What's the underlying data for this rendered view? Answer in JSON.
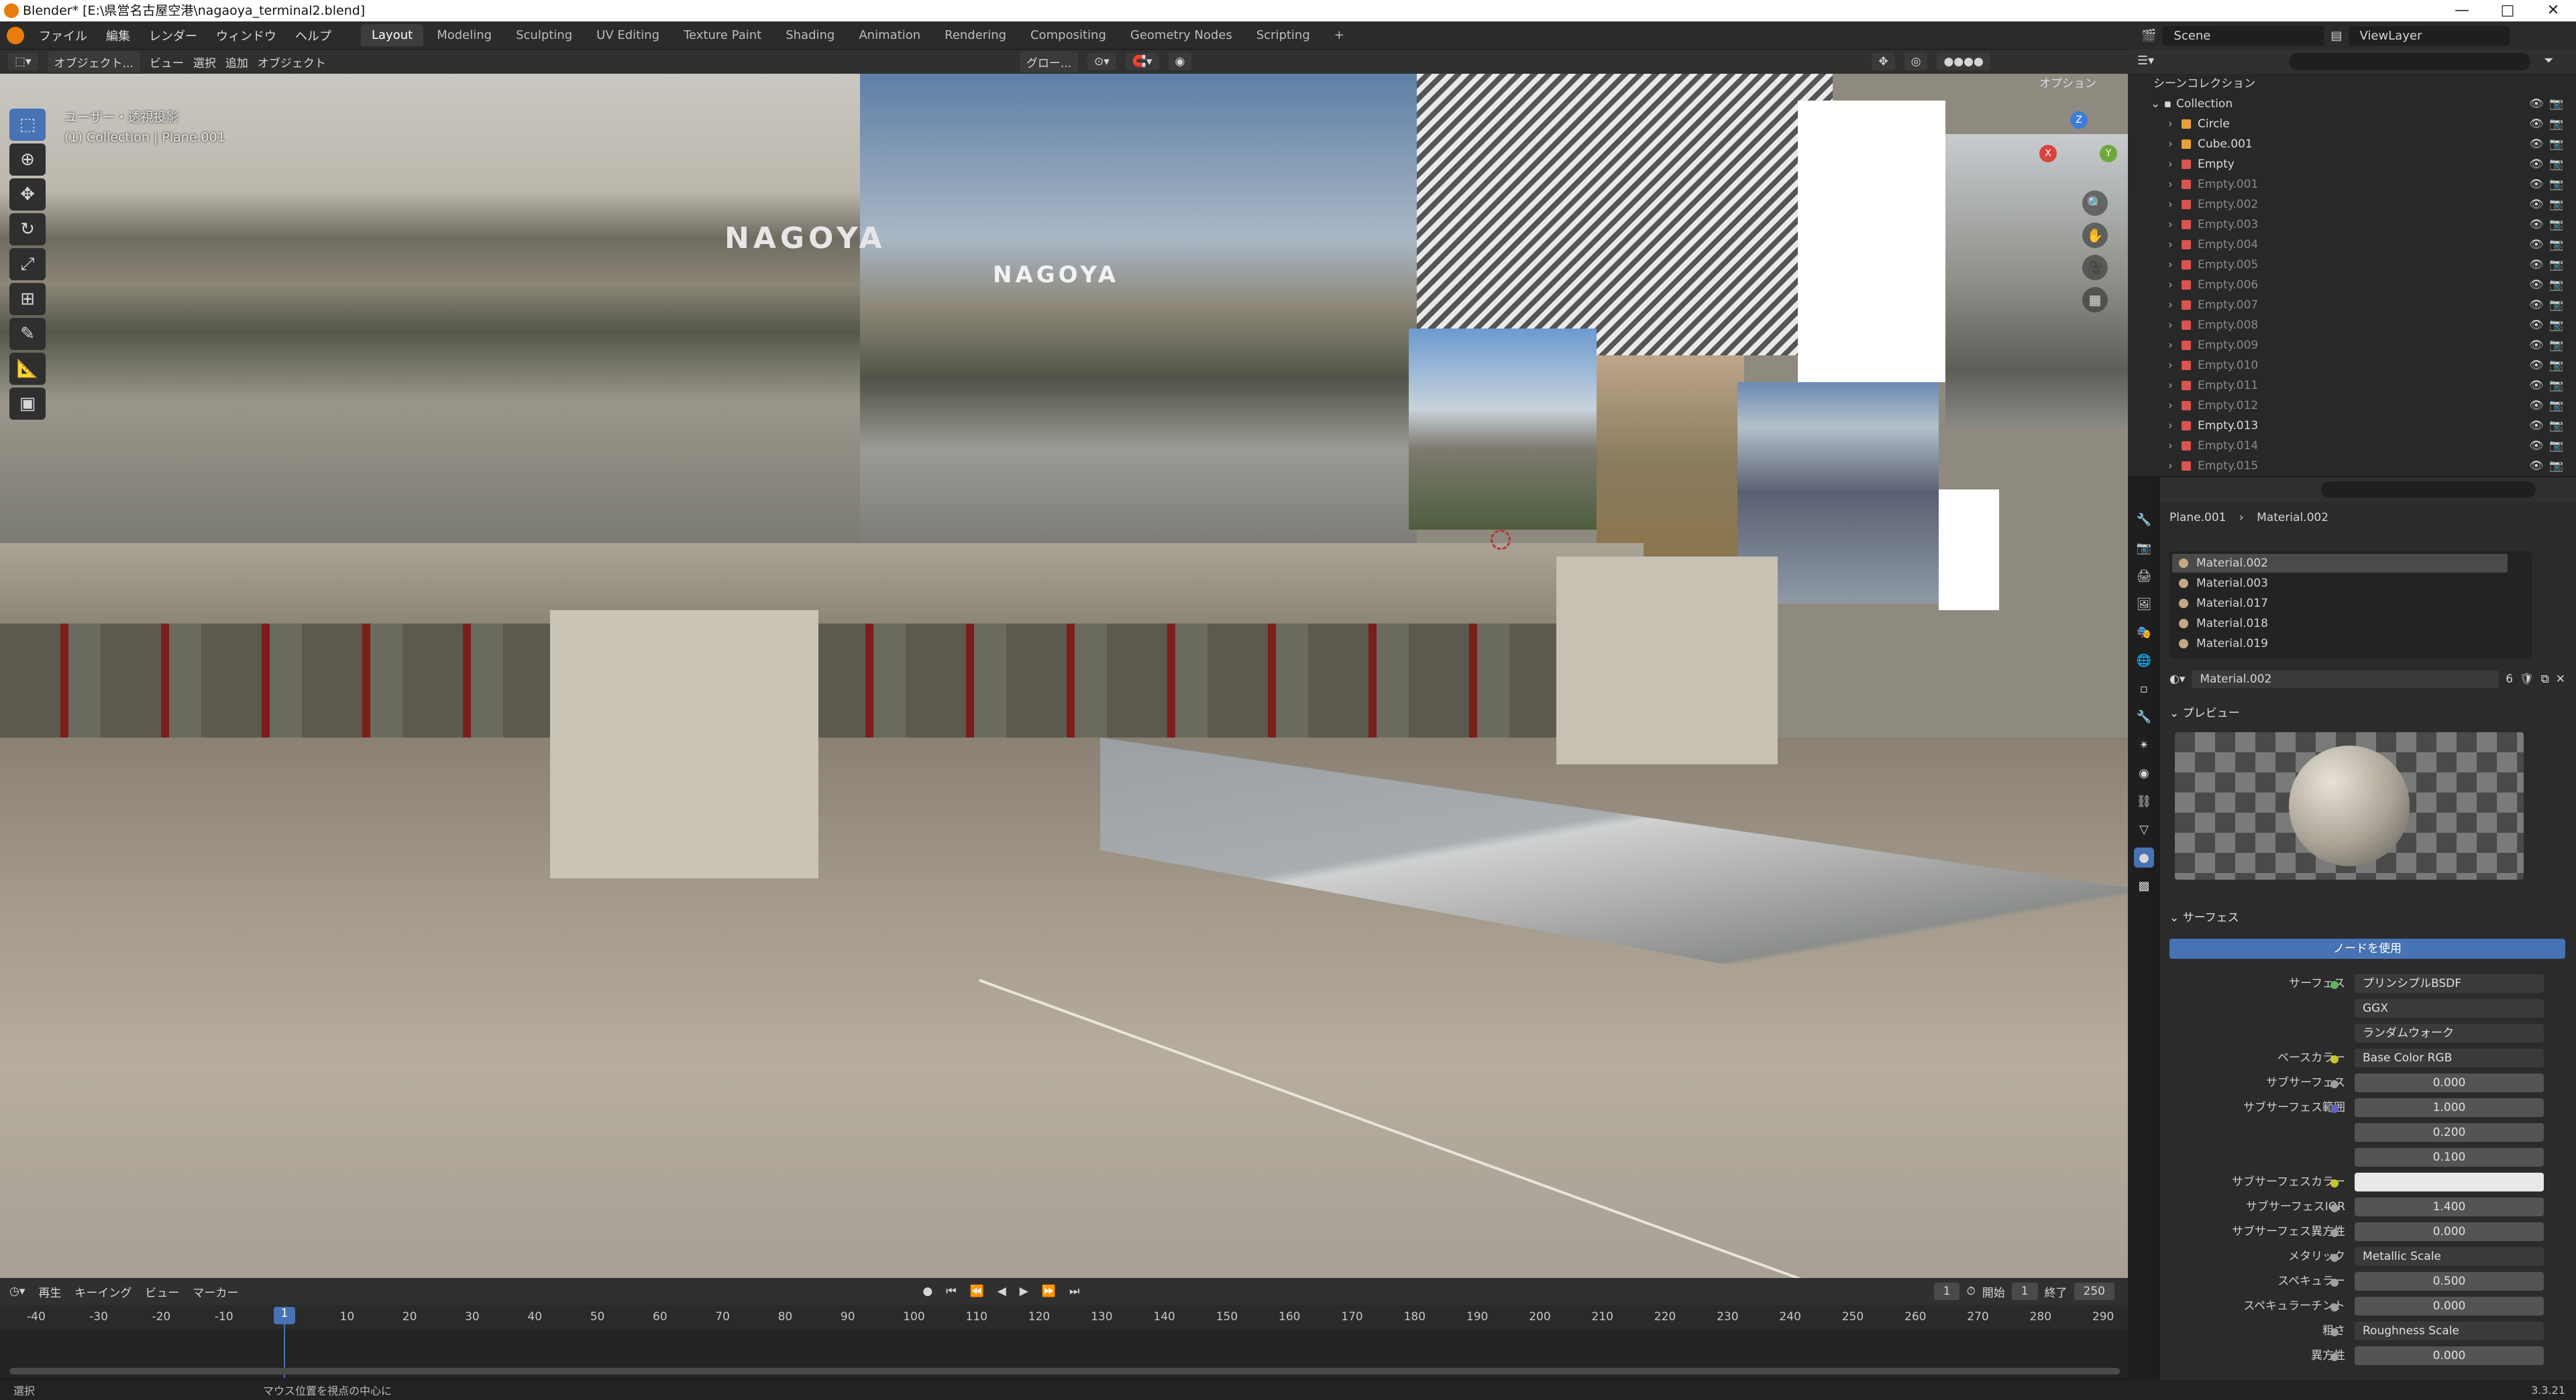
{
  "title_bar": {
    "text": "Blender* [E:\\県営名古屋空港\\nagaoya_terminal2.blend]",
    "min": "—",
    "max": "□",
    "close": "✕"
  },
  "top_menu": [
    "ファイル",
    "編集",
    "レンダー",
    "ウィンドウ",
    "ヘルプ"
  ],
  "workspaces": [
    "Layout",
    "Modeling",
    "Sculpting",
    "UV Editing",
    "Texture Paint",
    "Shading",
    "Animation",
    "Rendering",
    "Compositing",
    "Geometry Nodes",
    "Scripting",
    "+"
  ],
  "active_workspace": "Layout",
  "scene": {
    "label": "Scene",
    "view_layer": "ViewLayer"
  },
  "viewport_header": {
    "mode": "オブジェクト...",
    "menus": [
      "ビュー",
      "選択",
      "追加",
      "オブジェクト"
    ],
    "transform": "グロー...",
    "options": "オプション"
  },
  "viewport_info": {
    "line1": "ユーザー・透視投影",
    "line2": "(1) Collection | Plane.001",
    "sign1": "NAGOYA",
    "sign2": "NAGOYA"
  },
  "gizmo": {
    "x": "X",
    "y": "Y",
    "z": "Z"
  },
  "tools": [
    "select",
    "cursor",
    "move",
    "rotate",
    "scale",
    "transform",
    "annotate",
    "measure",
    "add-cube"
  ],
  "timeline": {
    "menus": [
      "再生",
      "キーイング",
      "ビュー",
      "マーカー"
    ],
    "current_frame": "1",
    "start_label": "開始",
    "start": "1",
    "end_label": "終了",
    "end": "250",
    "ticks": [
      "-40",
      "-30",
      "-20",
      "-10",
      "1",
      "10",
      "20",
      "30",
      "40",
      "50",
      "60",
      "70",
      "80",
      "90",
      "100",
      "110",
      "120",
      "130",
      "140",
      "150",
      "160",
      "170",
      "180",
      "190",
      "200",
      "210",
      "220",
      "230",
      "240",
      "250",
      "260",
      "270",
      "280",
      "290"
    ]
  },
  "status_bar": {
    "left": "選択",
    "middle": "マウス位置を視点の中心に",
    "version": "3.3.21"
  },
  "outliner": {
    "root": "シーンコレクション",
    "collection": "Collection",
    "items": [
      {
        "name": "Circle",
        "type": "mesh"
      },
      {
        "name": "Cube.001",
        "type": "mesh"
      },
      {
        "name": "Empty",
        "type": "empty"
      },
      {
        "name": "Empty.001",
        "type": "empty",
        "dim": true
      },
      {
        "name": "Empty.002",
        "type": "empty",
        "dim": true
      },
      {
        "name": "Empty.003",
        "type": "empty",
        "dim": true
      },
      {
        "name": "Empty.004",
        "type": "empty",
        "dim": true
      },
      {
        "name": "Empty.005",
        "type": "empty",
        "dim": true
      },
      {
        "name": "Empty.006",
        "type": "empty",
        "dim": true
      },
      {
        "name": "Empty.007",
        "type": "empty",
        "dim": true
      },
      {
        "name": "Empty.008",
        "type": "empty",
        "dim": true
      },
      {
        "name": "Empty.009",
        "type": "empty",
        "dim": true
      },
      {
        "name": "Empty.010",
        "type": "empty",
        "dim": true
      },
      {
        "name": "Empty.011",
        "type": "empty",
        "dim": true
      },
      {
        "name": "Empty.012",
        "type": "empty",
        "dim": true
      },
      {
        "name": "Empty.013",
        "type": "empty"
      },
      {
        "name": "Empty.014",
        "type": "empty",
        "dim": true
      },
      {
        "name": "Empty.015",
        "type": "empty",
        "dim": true
      }
    ]
  },
  "properties": {
    "breadcrumb": {
      "object": "Plane.001",
      "material": "Material.002"
    },
    "slots": [
      "Material.002",
      "Material.003",
      "Material.017",
      "Material.018",
      "Material.019"
    ],
    "active_slot": "Material.002",
    "material_name": "Material.002",
    "user_count": "6",
    "preview_label": "プレビュー",
    "surface_label": "サーフェス",
    "use_nodes": "ノードを使用",
    "fields": [
      {
        "label": "サーフェス",
        "value": "プリンシプルBSDF",
        "kind": "link",
        "dot": "#5fb55f"
      },
      {
        "label": "",
        "value": "GGX",
        "kind": "menu"
      },
      {
        "label": "",
        "value": "ランダムウォーク",
        "kind": "menu"
      },
      {
        "label": "ベースカラー",
        "value": "Base Color RGB",
        "kind": "link",
        "dot": "#c7c729"
      },
      {
        "label": "サブサーフェス",
        "value": "0.000",
        "kind": "num",
        "dot": "#a0a0a0"
      },
      {
        "label": "サブサーフェス範囲",
        "value": "1.000",
        "kind": "num",
        "dot": "#6363c7"
      },
      {
        "label": "",
        "value": "0.200",
        "kind": "num"
      },
      {
        "label": "",
        "value": "0.100",
        "kind": "num"
      },
      {
        "label": "サブサーフェスカラー",
        "value": "",
        "kind": "color",
        "dot": "#c7c729"
      },
      {
        "label": "サブサーフェスIOR",
        "value": "1.400",
        "kind": "num",
        "dot": "#a0a0a0"
      },
      {
        "label": "サブサーフェス異方性",
        "value": "0.000",
        "kind": "num",
        "dot": "#a0a0a0"
      },
      {
        "label": "メタリック",
        "value": "Metallic Scale",
        "kind": "link",
        "dot": "#a0a0a0"
      },
      {
        "label": "スペキュラー",
        "value": "0.500",
        "kind": "num",
        "dot": "#a0a0a0"
      },
      {
        "label": "スペキュラーチント",
        "value": "0.000",
        "kind": "num",
        "dot": "#a0a0a0"
      },
      {
        "label": "粗さ",
        "value": "Roughness Scale",
        "kind": "link",
        "dot": "#a0a0a0"
      },
      {
        "label": "異方性",
        "value": "0.000",
        "kind": "num",
        "dot": "#a0a0a0"
      }
    ]
  },
  "colors": {
    "accent": "#4772b3",
    "blender_orange": "#e87d0d",
    "mesh_icon": "#e8a03a",
    "empty_icon": "#d9534f"
  }
}
